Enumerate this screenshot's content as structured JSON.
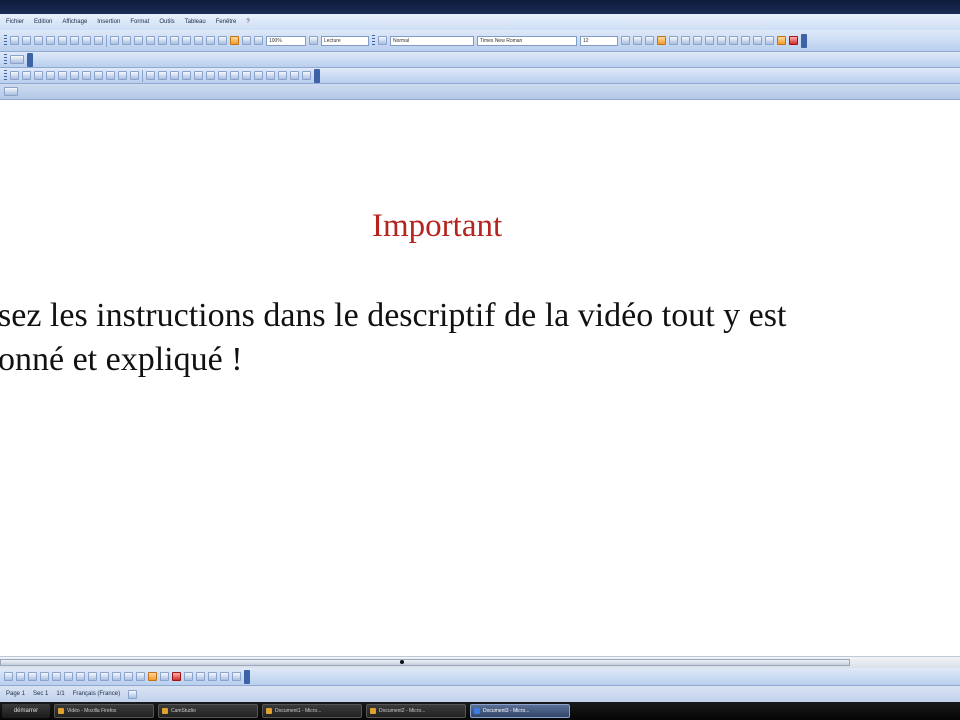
{
  "menu": {
    "items": [
      "Fichier",
      "Edition",
      "Affichage",
      "Insertion",
      "Format",
      "Outils",
      "Tableau",
      "Fenêtre",
      "?"
    ]
  },
  "toolbar": {
    "zoom_value": "100%",
    "read_mode_label": "Lecture",
    "style_value": "Normal",
    "font_value": "Times New Roman",
    "size_value": "12"
  },
  "document": {
    "heading": "Important",
    "paragraph_line1": "sez les instructions dans le descriptif de la vidéo tout y est",
    "paragraph_line2": "onné et expliqué !"
  },
  "statusbar": {
    "page": "Page 1",
    "section": "Sec 1",
    "page_count": "1/1",
    "language": "Français (France)"
  },
  "taskbar": {
    "start_label": "démarrer",
    "tasks": [
      "Vidéo - Mozilla Firefox",
      "CamStudio",
      "Document1 - Micro...",
      "Document2 - Micro...",
      "Document3 - Micro..."
    ],
    "active_task_index": 4
  },
  "colors": {
    "heading": "#b5241f",
    "body_text": "#111111",
    "toolbar_bg": "#b9cfee"
  }
}
